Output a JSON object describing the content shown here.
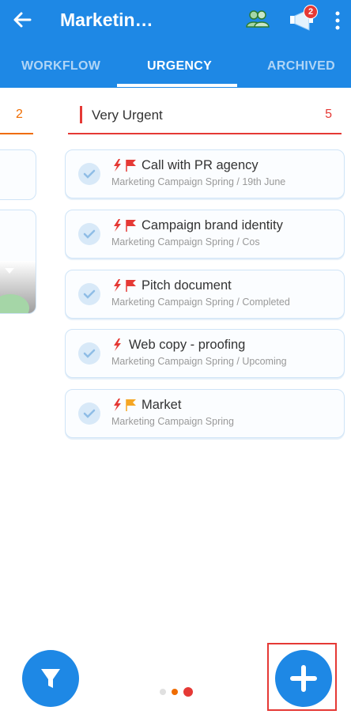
{
  "header": {
    "title": "Marketin…",
    "notification_count": "2"
  },
  "tabs": [
    {
      "label": "WORKFLOW"
    },
    {
      "label": "URGENCY"
    },
    {
      "label": "ARCHIVED"
    }
  ],
  "left_column": {
    "count": "2"
  },
  "column": {
    "name": "Very Urgent",
    "count": "5"
  },
  "tasks": [
    {
      "title": "Call with PR agency",
      "subtitle": "Marketing Campaign Spring / 19th June",
      "flag_color": "#e53935"
    },
    {
      "title": "Campaign brand identity",
      "subtitle": "Marketing Campaign Spring / Cos",
      "flag_color": "#e53935"
    },
    {
      "title": "Pitch document",
      "subtitle": "Marketing Campaign Spring / Completed",
      "flag_color": "#e53935"
    },
    {
      "title": "Web copy - proofing",
      "subtitle": "Marketing Campaign Spring / Upcoming",
      "flag_color": ""
    },
    {
      "title": "Market",
      "subtitle": "Marketing Campaign Spring",
      "flag_color": "#f5a623"
    }
  ],
  "colors": {
    "primary": "#1e88e5",
    "urgent": "#e53935",
    "warning": "#ef6c00"
  }
}
